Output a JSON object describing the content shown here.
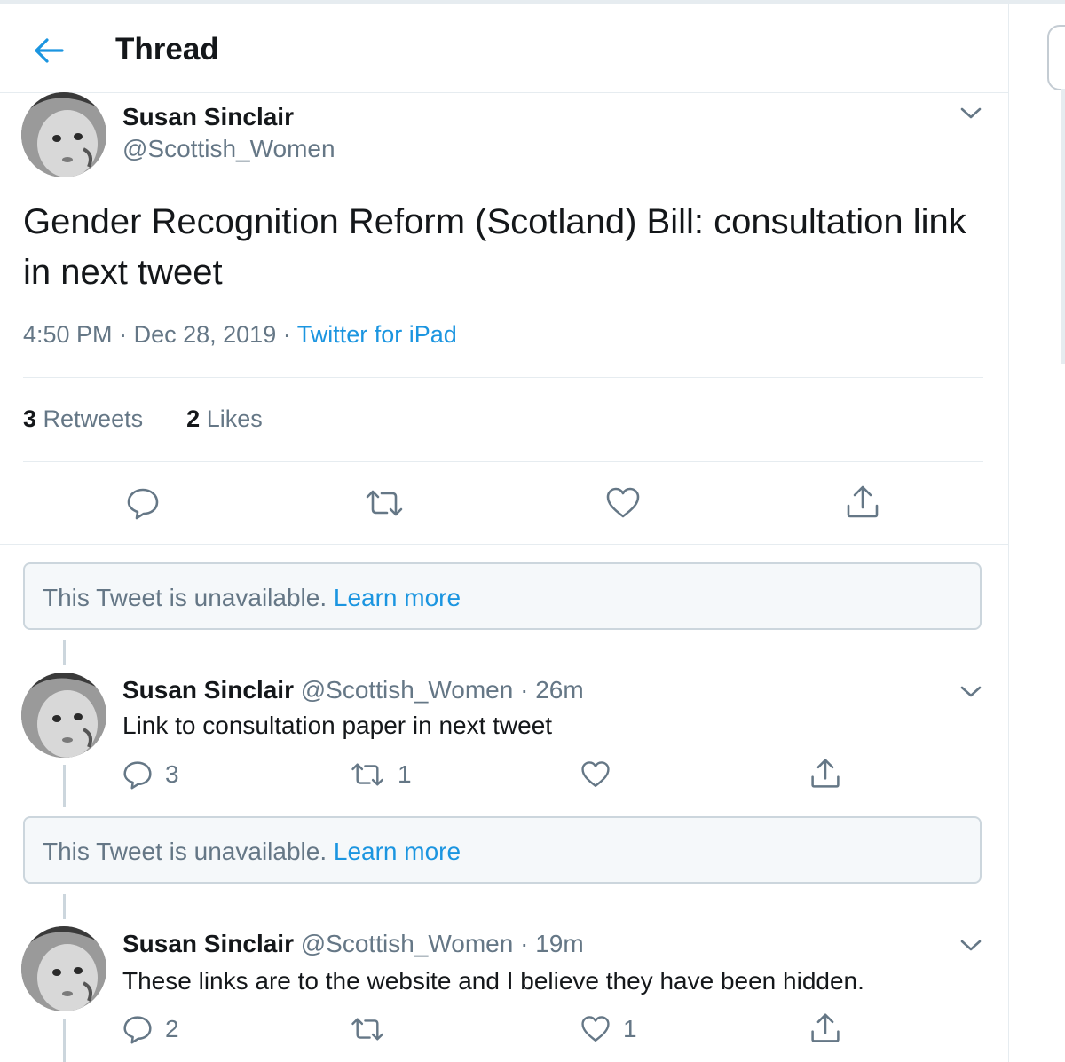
{
  "header": {
    "title": "Thread",
    "back_icon": "arrow-left-icon"
  },
  "main_tweet": {
    "name": "Susan Sinclair",
    "handle": "@Scottish_Women",
    "text": "Gender Recognition Reform (Scotland) Bill: consultation link in next tweet",
    "time": "4:50 PM",
    "sep1": "·",
    "date": "Dec 28, 2019",
    "sep2": "·",
    "source": "Twitter for iPad",
    "retweets_count": "3",
    "retweets_label": "Retweets",
    "likes_count": "2",
    "likes_label": "Likes"
  },
  "unavailable_1": {
    "text": "This Tweet is unavailable.",
    "link": "Learn more"
  },
  "reply_1": {
    "name": "Susan Sinclair",
    "handle": "@Scottish_Women",
    "sep": "·",
    "time": "26m",
    "text": "Link to consultation paper in next tweet",
    "reply_count": "3",
    "retweet_count": "1",
    "like_count": ""
  },
  "unavailable_2": {
    "text": "This Tweet is unavailable.",
    "link": "Learn more"
  },
  "reply_2": {
    "name": "Susan Sinclair",
    "handle": "@Scottish_Women",
    "sep": "·",
    "time": "19m",
    "text": "These links are to the website and I believe they have been hidden.",
    "reply_count": "2",
    "retweet_count": "",
    "like_count": "1"
  },
  "colors": {
    "accent": "#1b95e0",
    "muted": "#657786",
    "text": "#14171a",
    "border": "#e6ecf0",
    "unavailable_bg": "#f5f8fa"
  }
}
